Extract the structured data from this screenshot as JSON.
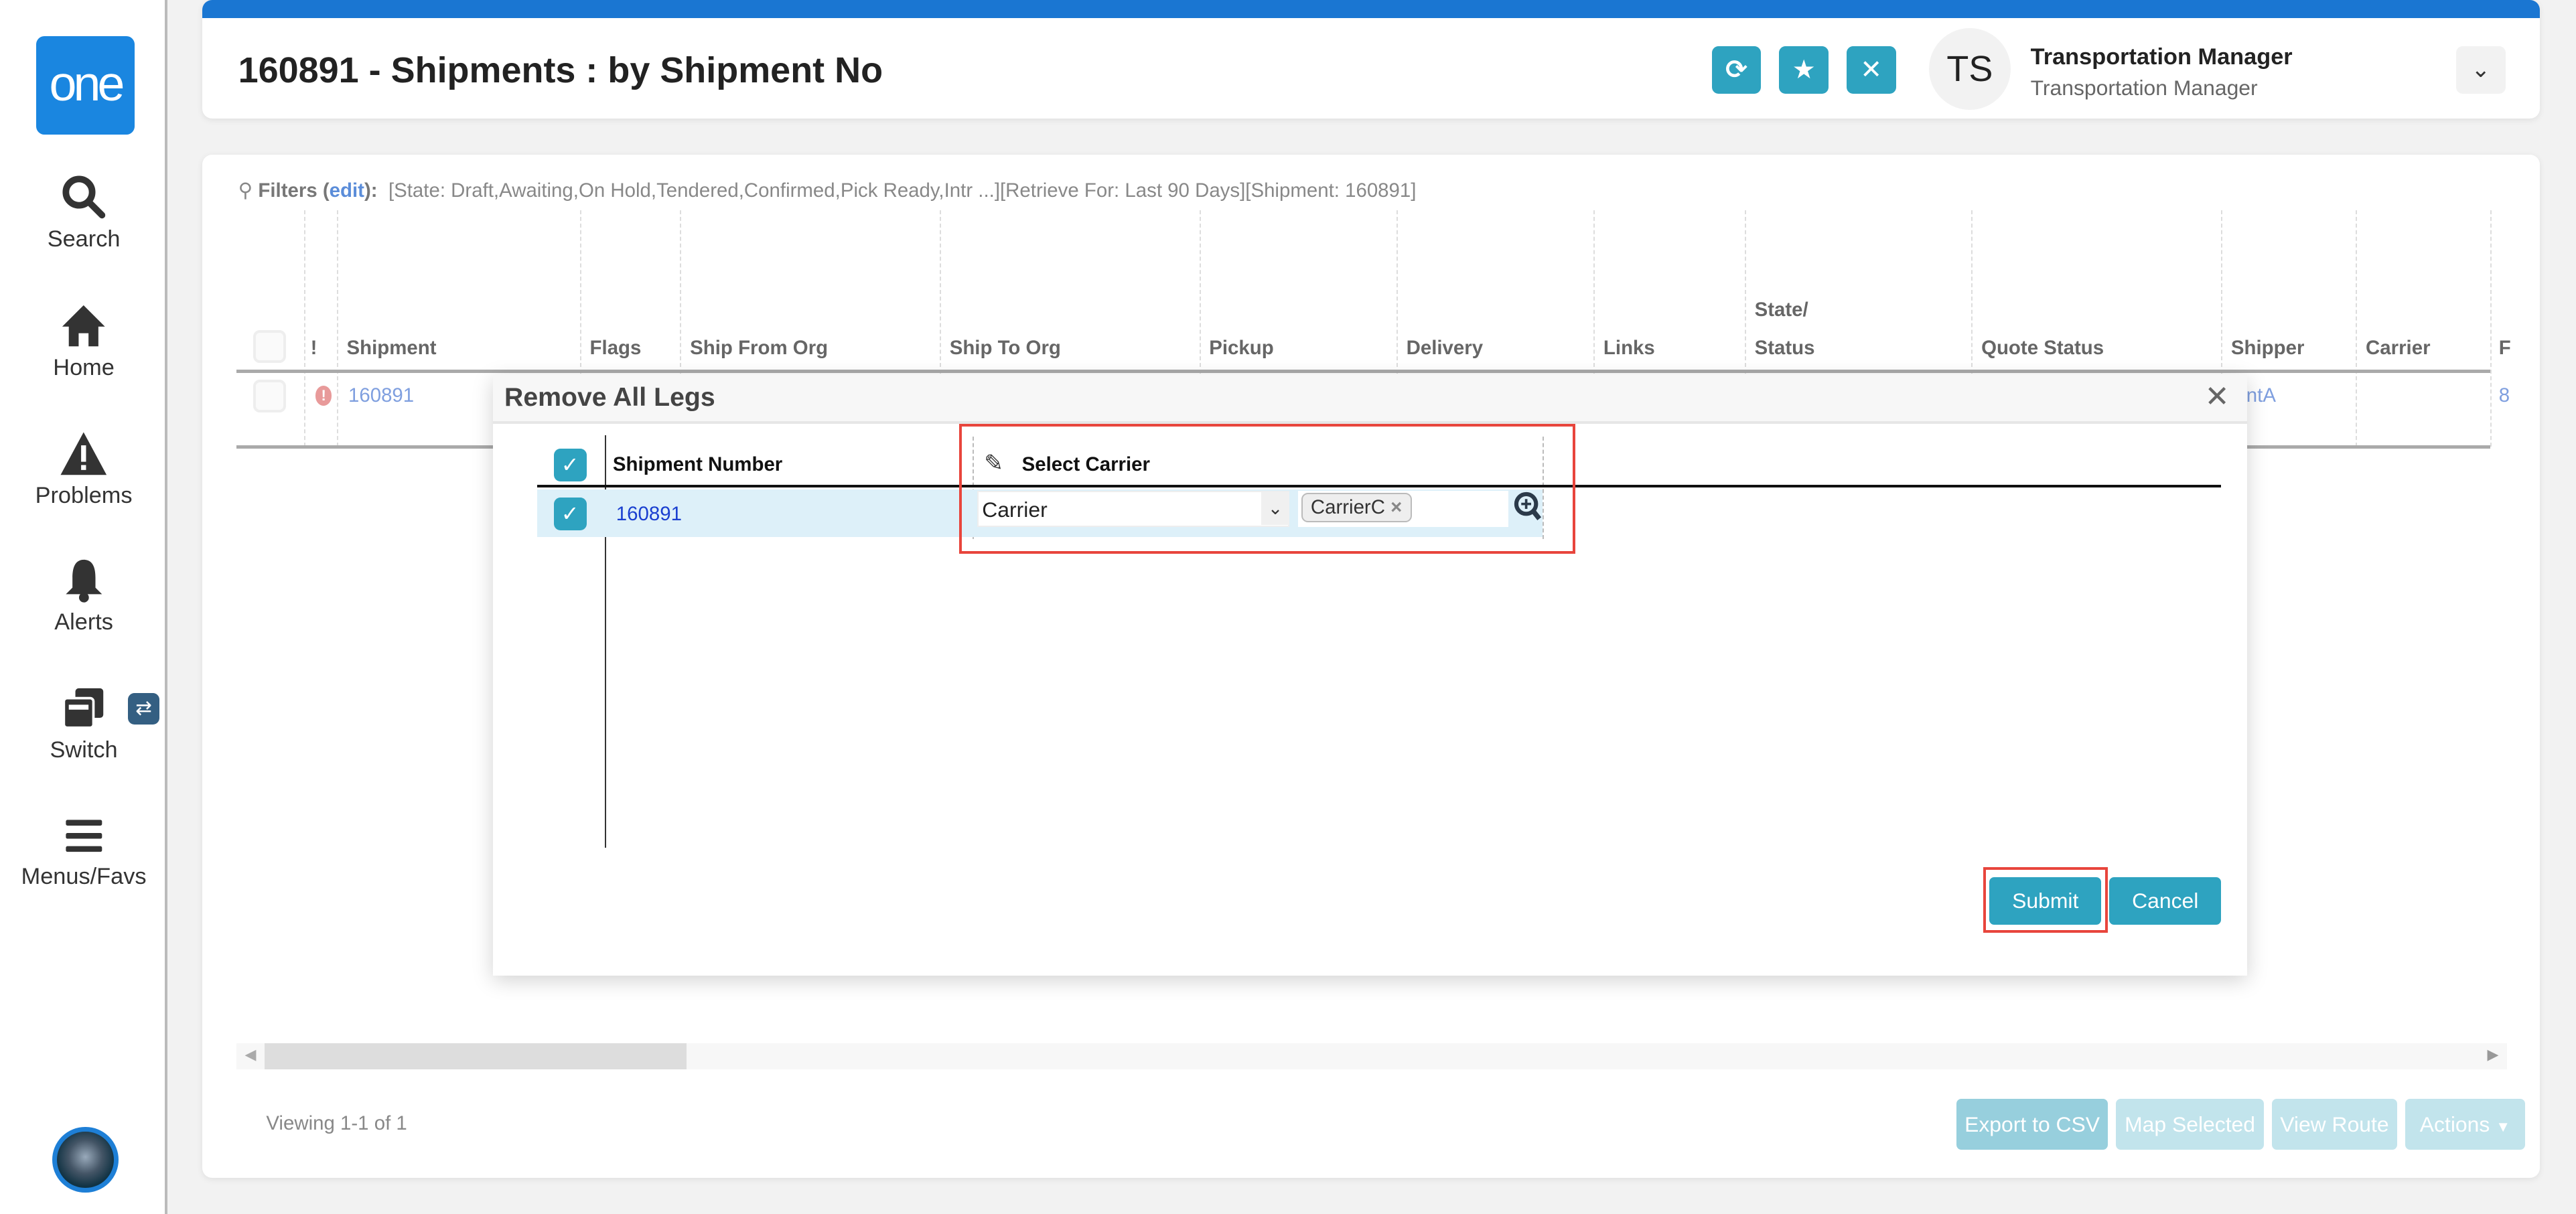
{
  "sidebar": {
    "logo": "one",
    "items": [
      {
        "label": "Search",
        "icon": "search-icon"
      },
      {
        "label": "Home",
        "icon": "home-icon"
      },
      {
        "label": "Problems",
        "icon": "warning-icon"
      },
      {
        "label": "Alerts",
        "icon": "bell-icon"
      },
      {
        "label": "Switch",
        "icon": "windows-icon"
      },
      {
        "label": "Menus/Favs",
        "icon": "menu-icon"
      }
    ],
    "switch_badge": "⇄"
  },
  "header": {
    "title": "160891 - Shipments : by Shipment No",
    "buttons": [
      "refresh-icon",
      "star-icon",
      "close-icon"
    ],
    "user_initials": "TS",
    "user_name": "Transportation Manager",
    "user_role": "Transportation Manager",
    "accent": "#1a76d2"
  },
  "filters": {
    "label": "Filters (",
    "edit": "edit",
    "label_end": "):",
    "value": "[State: Draft,Awaiting,On Hold,Tendered,Confirmed,Pick Ready,Intr ...][Retrieve For: Last 90 Days][Shipment: 160891]"
  },
  "table": {
    "columns": [
      "!",
      "Shipment",
      "Flags",
      "Ship From Org",
      "Ship To Org",
      "Pickup",
      "Delivery",
      "Links",
      "State/",
      "Status",
      "Quote Status",
      "Shipper",
      "Carrier",
      "F"
    ],
    "rows": [
      {
        "shipment": "160891",
        "shipper": "ientA",
        "extra": "8"
      }
    ]
  },
  "footer": {
    "viewing": "Viewing 1-1 of 1",
    "buttons": [
      "Export to CSV",
      "Map Selected",
      "View Route",
      "Actions"
    ]
  },
  "modal": {
    "title": "Remove All Legs",
    "close": "✕",
    "columns": [
      "Shipment Number",
      "Select Carrier"
    ],
    "row": {
      "shipment": "160891",
      "carrier_type": "Carrier",
      "carrier_chip": "CarrierC"
    },
    "submit": "Submit",
    "cancel": "Cancel"
  }
}
